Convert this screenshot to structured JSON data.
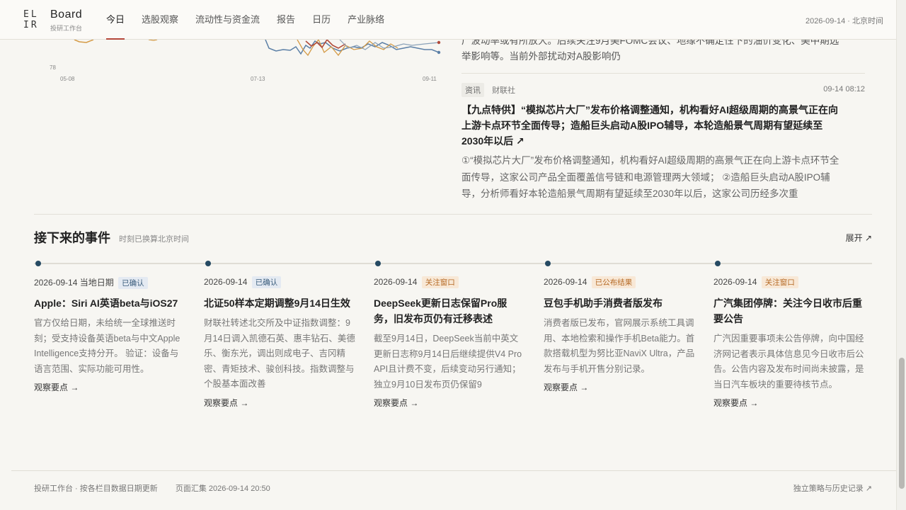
{
  "header": {
    "logo_text": "EL IR",
    "brand": "Board",
    "brand_sub": "投研工作台",
    "nav": [
      "今日",
      "选股观察",
      "流动性与资金流",
      "报告",
      "日历",
      "产业脉络"
    ],
    "active_nav": "今日",
    "date": "2026-09-14 · 北京时间"
  },
  "chart_data": {
    "type": "line",
    "y_visible_tick": "78",
    "x_ticks": [
      "05-08",
      "07-13",
      "09-11"
    ],
    "note_colors": {
      "series_a": "#5b7fa6",
      "series_b": "#d49a45",
      "series_c": "#b14a3a",
      "series_d": "#8aa1b8"
    }
  },
  "news": {
    "prev_fragment": "广波动率或有所放大。后续关注9月美FOMC会议、地缘不确定性下的油价变化、美中期选举影响等。当前外部扰动对A股影响仍",
    "item": {
      "tag": "资讯",
      "source": "财联社",
      "time": "09-14 08:12",
      "title": "【九点特供】“模拟芯片大厂”发布价格调整通知，机构看好AI超级周期的高景气正在向上游卡点环节全面传导；造船巨头启动A股IPO辅导，本轮造船景气周期有望延续至2030年以后 ↗",
      "body": "①“模拟芯片大厂”发布价格调整通知，机构看好AI超级周期的高景气正在向上游卡点环节全面传导，这家公司产品全面覆盖信号链和电源管理两大领域； ②造船巨头启动A股IPO辅导，分析师看好本轮造船景气周期有望延续至2030年以后，这家公司历经多次重"
    }
  },
  "events": {
    "title": "接下来的事件",
    "subtitle": "时刻已换算北京时间",
    "expand": "展开 ↗",
    "link_label": "观察要点 →",
    "items": [
      {
        "date": "2026-09-14",
        "date_note": "当地日期",
        "badge": "已确认",
        "badge_type": "confirmed",
        "title": "Apple：Siri AI英语beta与iOS27",
        "desc": "官方仅给日期，未给统一全球推送时刻；受支持设备英语beta与中文Apple Intelligence支持分开。 验证：设备与语言范围、实际功能可用性。"
      },
      {
        "date": "2026-09-14",
        "date_note": "",
        "badge": "已确认",
        "badge_type": "confirmed",
        "title": "北证50样本定期调整9月14日生效",
        "desc": "财联社转述北交所及中证指数调整：9月14日调入凯德石英、惠丰钻石、美德乐、衡东光，调出则成电子、吉冈精密、青矩技术、骏创科技。指数调整与个股基本面改善"
      },
      {
        "date": "2026-09-14",
        "date_note": "",
        "badge": "关注窗口",
        "badge_type": "watch",
        "title": "DeepSeek更新日志保留Pro服务，旧发布页仍有迁移表述",
        "desc": "截至9月14日，DeepSeek当前中英文更新日志称9月14日后继续提供V4 Pro API且计费不变，后续变动另行通知；独立9月10日发布页仍保留9"
      },
      {
        "date": "2026-09-14",
        "date_note": "",
        "badge": "已公布结果",
        "badge_type": "watch",
        "title": "豆包手机助手消费者版发布",
        "desc": "消费者版已发布，官网展示系统工具调用、本地检索和操作手机Beta能力。首款搭载机型为努比亚NaviX Ultra，产品发布与手机开售分别记录。"
      },
      {
        "date": "2026-09-14",
        "date_note": "",
        "badge": "关注窗口",
        "badge_type": "watch",
        "title": "广汽集团停牌：关注今日收市后重要公告",
        "desc": "广汽因重要事项未公告停牌，向中国经济网记者表示具体信息见今日收市后公告。公告内容及发布时间尚未披露，是当日汽车板块的重要待核节点。"
      }
    ]
  },
  "footer": {
    "left": "投研工作台 · 按各栏目数据日期更新",
    "stamp": "页面汇集 2026-09-14 20:50",
    "right": "独立策略与历史记录 ↗"
  }
}
